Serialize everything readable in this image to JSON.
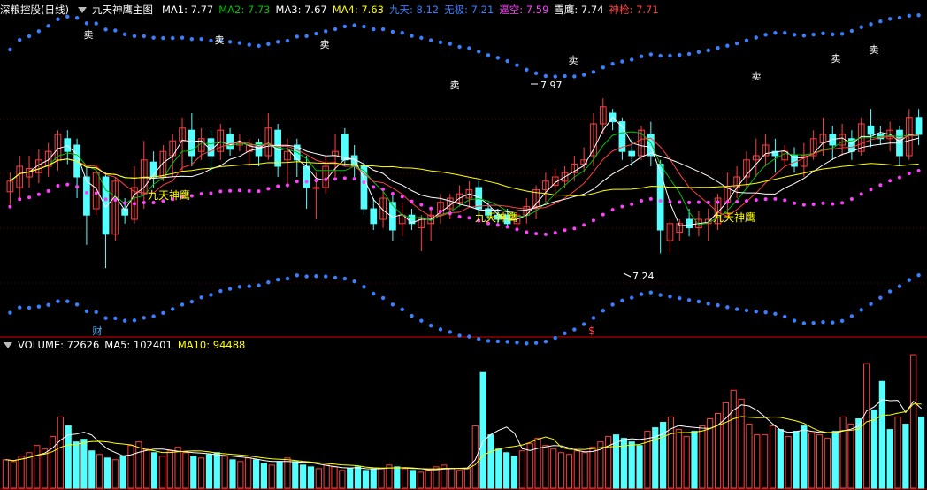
{
  "colors": {
    "up": "#ff4040",
    "down": "#54ffff",
    "ma1": "#ffffff",
    "ma2": "#00c000",
    "ma3": "#ffffff",
    "ma4": "#ffff00",
    "jiutian": "#3a7fff",
    "wuji": "#3a7fff",
    "bikong": "#ff40ff",
    "xueying": "#ffffff",
    "shenqiang": "#ff4040",
    "ma10": "#ffff00"
  },
  "header": {
    "stock_name": "深粮控股(日线)",
    "indicator": "九天神鹰主图",
    "items": [
      {
        "label": "MA1:",
        "value": "7.77",
        "color": "#ffffff"
      },
      {
        "label": "MA2:",
        "value": "7.73",
        "color": "#00c000"
      },
      {
        "label": "MA3:",
        "value": "7.67",
        "color": "#ffffff"
      },
      {
        "label": "MA4:",
        "value": "7.63",
        "color": "#ffff00"
      },
      {
        "label": "九天:",
        "value": "8.12",
        "color": "#3a7fff"
      },
      {
        "label": "无极:",
        "value": "7.21",
        "color": "#3a7fff"
      },
      {
        "label": "逼空:",
        "value": "7.59",
        "color": "#ff40ff"
      },
      {
        "label": "雪鹰:",
        "value": "7.74",
        "color": "#ffffff"
      },
      {
        "label": "神枪:",
        "value": "7.71",
        "color": "#ff4040"
      }
    ]
  },
  "volume_header": {
    "items": [
      {
        "label": "VOLUME:",
        "value": "72626",
        "color": "#ffffff"
      },
      {
        "label": "MA5:",
        "value": "102401",
        "color": "#ffffff"
      },
      {
        "label": "MA10:",
        "value": "94488",
        "color": "#ffff00"
      }
    ]
  },
  "annotations": {
    "sell": "卖",
    "signal": "九天神鹰",
    "fin": "财",
    "dollar": "$",
    "high_label": "7.97",
    "low_label": "7.24"
  },
  "chart_data": {
    "type": "candlestick",
    "price_range": [
      6.85,
      8.35
    ],
    "volume_max": 150000,
    "candles": [
      [
        7.53,
        7.58,
        7.47,
        7.62
      ],
      [
        7.55,
        7.65,
        7.5,
        7.7
      ],
      [
        7.6,
        7.64,
        7.55,
        7.7
      ],
      [
        7.62,
        7.68,
        7.57,
        7.73
      ],
      [
        7.65,
        7.72,
        7.6,
        7.76
      ],
      [
        7.68,
        7.8,
        7.63,
        7.82
      ],
      [
        7.78,
        7.72,
        7.66,
        7.82
      ],
      [
        7.75,
        7.6,
        7.5,
        7.78
      ],
      [
        7.6,
        7.42,
        7.28,
        7.65
      ],
      [
        7.45,
        7.62,
        7.42,
        7.66
      ],
      [
        7.6,
        7.33,
        7.17,
        7.62
      ],
      [
        7.33,
        7.58,
        7.3,
        7.6
      ],
      [
        7.45,
        7.42,
        7.38,
        7.5
      ],
      [
        7.4,
        7.55,
        7.38,
        7.65
      ],
      [
        7.52,
        7.68,
        7.45,
        7.77
      ],
      [
        7.67,
        7.6,
        7.55,
        7.72
      ],
      [
        7.6,
        7.72,
        7.58,
        7.75
      ],
      [
        7.7,
        7.77,
        7.6,
        7.8
      ],
      [
        7.77,
        7.83,
        7.63,
        7.88
      ],
      [
        7.82,
        7.7,
        7.65,
        7.9
      ],
      [
        7.72,
        7.78,
        7.68,
        7.83
      ],
      [
        7.78,
        7.7,
        7.62,
        7.82
      ],
      [
        7.72,
        7.82,
        7.68,
        7.85
      ],
      [
        7.8,
        7.73,
        7.7,
        7.83
      ],
      [
        7.75,
        7.76,
        7.72,
        7.8
      ],
      [
        7.72,
        7.75,
        7.65,
        7.78
      ],
      [
        7.76,
        7.7,
        7.65,
        7.78
      ],
      [
        7.7,
        7.83,
        7.68,
        7.9
      ],
      [
        7.82,
        7.65,
        7.6,
        7.85
      ],
      [
        7.68,
        7.72,
        7.55,
        7.78
      ],
      [
        7.75,
        7.68,
        7.6,
        7.78
      ],
      [
        7.65,
        7.55,
        7.45,
        7.7
      ],
      [
        7.55,
        7.55,
        7.4,
        7.62
      ],
      [
        7.55,
        7.65,
        7.52,
        7.7
      ],
      [
        7.7,
        7.72,
        7.6,
        7.8
      ],
      [
        7.8,
        7.68,
        7.65,
        7.83
      ],
      [
        7.7,
        7.65,
        7.6,
        7.75
      ],
      [
        7.65,
        7.45,
        7.42,
        7.68
      ],
      [
        7.45,
        7.38,
        7.35,
        7.5
      ],
      [
        7.4,
        7.5,
        7.36,
        7.55
      ],
      [
        7.48,
        7.35,
        7.3,
        7.52
      ],
      [
        7.38,
        7.42,
        7.32,
        7.48
      ],
      [
        7.42,
        7.38,
        7.35,
        7.45
      ],
      [
        7.36,
        7.4,
        7.25,
        7.42
      ],
      [
        7.38,
        7.42,
        7.3,
        7.45
      ],
      [
        7.42,
        7.48,
        7.38,
        7.52
      ],
      [
        7.45,
        7.5,
        7.4,
        7.52
      ],
      [
        7.48,
        7.52,
        7.46,
        7.56
      ],
      [
        7.5,
        7.54,
        7.46,
        7.58
      ],
      [
        7.55,
        7.45,
        7.4,
        7.58
      ],
      [
        7.45,
        7.42,
        7.4,
        7.48
      ],
      [
        7.42,
        7.4,
        7.38,
        7.45
      ],
      [
        7.42,
        7.38,
        7.36,
        7.45
      ],
      [
        7.38,
        7.42,
        7.36,
        7.44
      ],
      [
        7.42,
        7.46,
        7.38,
        7.5
      ],
      [
        7.46,
        7.54,
        7.4,
        7.56
      ],
      [
        7.54,
        7.58,
        7.48,
        7.62
      ],
      [
        7.56,
        7.6,
        7.5,
        7.64
      ],
      [
        7.58,
        7.62,
        7.55,
        7.65
      ],
      [
        7.62,
        7.66,
        7.58,
        7.7
      ],
      [
        7.66,
        7.68,
        7.62,
        7.74
      ],
      [
        7.7,
        7.85,
        7.65,
        7.9
      ],
      [
        7.85,
        7.93,
        7.8,
        7.97
      ],
      [
        7.9,
        7.86,
        7.82,
        7.92
      ],
      [
        7.86,
        7.72,
        7.68,
        7.88
      ],
      [
        7.72,
        7.7,
        7.65,
        7.78
      ],
      [
        7.7,
        7.82,
        7.68,
        7.84
      ],
      [
        7.8,
        7.7,
        7.65,
        7.86
      ],
      [
        7.66,
        7.35,
        7.24,
        7.68
      ],
      [
        7.3,
        7.38,
        7.24,
        7.4
      ],
      [
        7.34,
        7.38,
        7.3,
        7.4
      ],
      [
        7.4,
        7.36,
        7.32,
        7.45
      ],
      [
        7.36,
        7.4,
        7.32,
        7.44
      ],
      [
        7.38,
        7.4,
        7.3,
        7.45
      ],
      [
        7.38,
        7.5,
        7.35,
        7.52
      ],
      [
        7.48,
        7.55,
        7.42,
        7.62
      ],
      [
        7.55,
        7.6,
        7.5,
        7.65
      ],
      [
        7.6,
        7.68,
        7.55,
        7.72
      ],
      [
        7.68,
        7.7,
        7.6,
        7.78
      ],
      [
        7.7,
        7.75,
        7.65,
        7.8
      ],
      [
        7.72,
        7.7,
        7.62,
        7.78
      ],
      [
        7.68,
        7.72,
        7.65,
        7.75
      ],
      [
        7.7,
        7.65,
        7.62,
        7.74
      ],
      [
        7.65,
        7.7,
        7.6,
        7.76
      ],
      [
        7.7,
        7.78,
        7.68,
        7.82
      ],
      [
        7.76,
        7.8,
        7.7,
        7.88
      ],
      [
        7.8,
        7.75,
        7.68,
        7.84
      ],
      [
        7.75,
        7.8,
        7.7,
        7.85
      ],
      [
        7.78,
        7.72,
        7.68,
        7.82
      ],
      [
        7.72,
        7.85,
        7.7,
        7.88
      ],
      [
        7.84,
        7.8,
        7.74,
        7.92
      ],
      [
        7.8,
        7.78,
        7.75,
        7.84
      ],
      [
        7.78,
        7.82,
        7.72,
        7.86
      ],
      [
        7.82,
        7.7,
        7.65,
        7.84
      ],
      [
        7.7,
        7.88,
        7.68,
        7.92
      ],
      [
        7.88,
        7.8,
        7.75,
        7.92
      ]
    ],
    "volume": [
      32,
      30,
      36,
      40,
      48,
      44,
      58,
      80,
      70,
      52,
      55,
      42,
      38,
      34,
      32,
      36,
      48,
      52,
      44,
      40,
      36,
      42,
      46,
      40,
      36,
      34,
      38,
      40,
      36,
      32,
      30,
      34,
      32,
      28,
      26,
      30,
      34,
      30,
      26,
      24,
      22,
      26,
      24,
      20,
      22,
      24,
      20,
      22,
      22,
      26,
      24,
      22,
      20,
      18,
      20,
      24,
      26,
      22,
      20,
      22,
      70,
      130,
      60,
      44,
      40,
      36,
      42,
      50,
      56,
      48,
      44,
      40,
      38,
      42,
      40,
      46,
      52,
      58,
      60,
      56,
      52,
      48,
      64,
      68,
      74,
      80,
      66,
      58,
      64,
      70,
      78,
      84,
      96,
      110,
      100,
      72,
      60,
      60,
      70,
      66,
      58,
      64,
      70,
      62,
      60,
      56,
      64,
      80,
      72,
      78,
      140,
      88,
      120,
      66,
      80,
      72,
      150,
      80
    ]
  }
}
